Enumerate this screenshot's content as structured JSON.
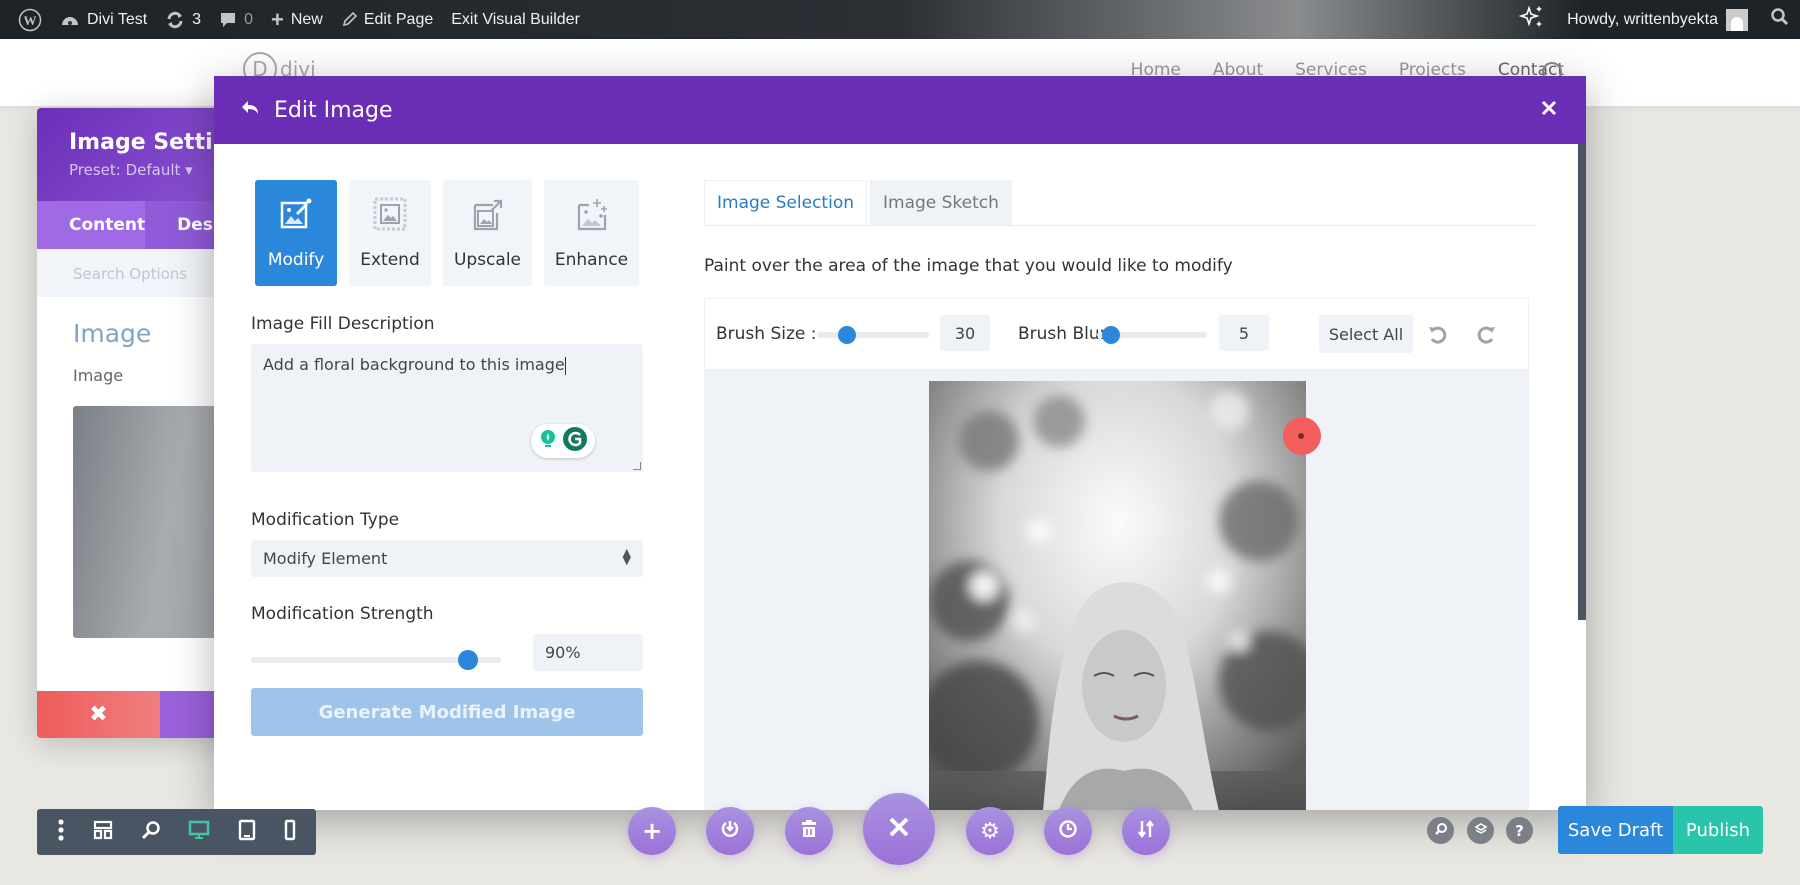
{
  "admin_bar": {
    "site_name": "Divi Test",
    "updates_count": "3",
    "comments_count": "0",
    "new_label": "New",
    "edit_page_label": "Edit Page",
    "exit_builder_label": "Exit Visual Builder",
    "greeting": "Howdy, writtenbyekta"
  },
  "site": {
    "logo_text": "divi",
    "logo_letter": "D",
    "nav": [
      "Home",
      "About",
      "Services",
      "Projects",
      "Contact"
    ]
  },
  "settings_panel": {
    "title": "Image Settings",
    "preset": "Preset: Default ▾",
    "tabs": [
      "Content",
      "Design"
    ],
    "search_placeholder": "Search Options",
    "section_title": "Image",
    "field_label": "Image"
  },
  "modal": {
    "title": "Edit Image",
    "modes": [
      {
        "label": "Modify",
        "active": true
      },
      {
        "label": "Extend",
        "active": false
      },
      {
        "label": "Upscale",
        "active": false
      },
      {
        "label": "Enhance",
        "active": false
      }
    ],
    "fill_description_label": "Image Fill Description",
    "fill_description_value": "Add a floral background to this image",
    "modification_type_label": "Modification Type",
    "modification_type_value": "Modify Element",
    "modification_strength_label": "Modification Strength",
    "modification_strength_value": "90%",
    "modification_strength_percent": 90,
    "generate_button": "Generate Modified Image",
    "tabs": [
      {
        "label": "Image Selection",
        "active": true
      },
      {
        "label": "Image Sketch",
        "active": false
      }
    ],
    "instruction": "Paint over the area of the image that you would like to modify",
    "brush_size_label": "Brush Size :",
    "brush_size_value": "30",
    "brush_size_fraction": 0.22,
    "brush_blur_label": "Brush Blur :",
    "brush_blur_value": "5",
    "brush_blur_fraction": 0.05,
    "select_all_label": "Select All"
  },
  "bottom": {
    "save_draft": "Save Draft",
    "publish": "Publish"
  },
  "colors": {
    "modal_header": "#6a2db5",
    "accent_blue": "#2b87da",
    "publish_green": "#29c4a9",
    "fab_purple": "#9b72d8"
  }
}
